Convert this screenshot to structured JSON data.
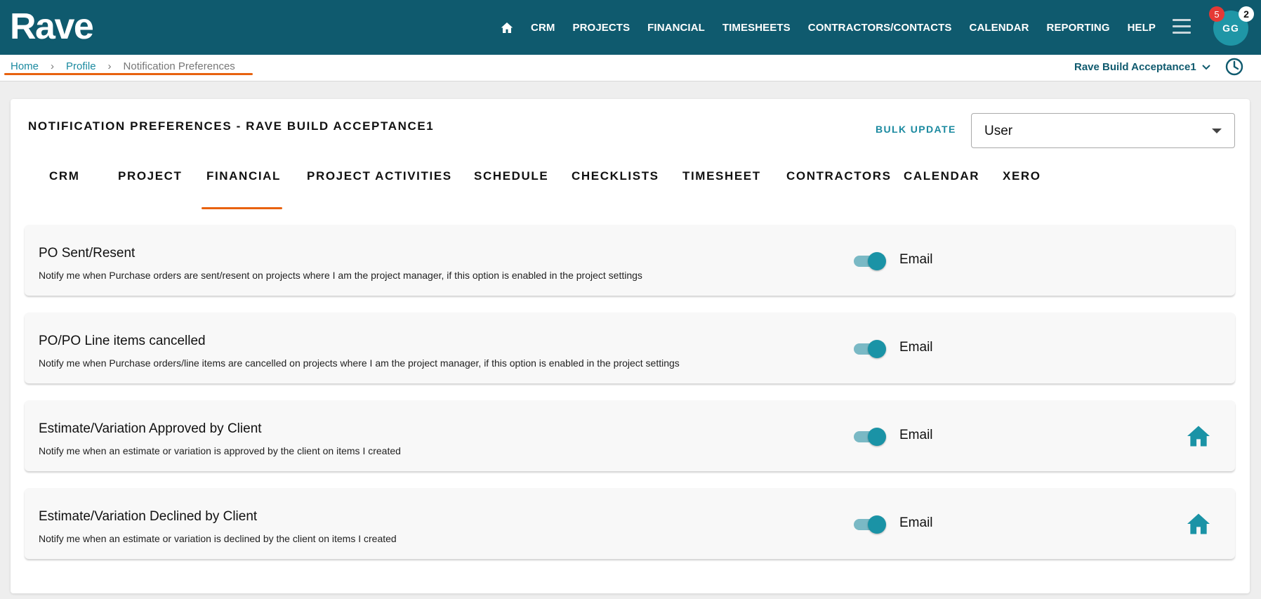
{
  "app": {
    "logo": "Rave"
  },
  "nav": {
    "items": [
      "CRM",
      "PROJECTS",
      "FINANCIAL",
      "TIMESHEETS",
      "CONTRACTORS/CONTACTS",
      "CALENDAR",
      "REPORTING",
      "HELP"
    ],
    "icons": {
      "home": "home-icon",
      "menu": "hamburger-menu-icon"
    }
  },
  "user": {
    "initials": "GG",
    "notification_count": "5",
    "secondary_count": "2"
  },
  "breadcrumb": {
    "home": "Home",
    "profile": "Profile",
    "current": "Notification Preferences"
  },
  "company": {
    "name": "Rave Build Acceptance1"
  },
  "page": {
    "title": "NOTIFICATION PREFERENCES - RAVE BUILD ACCEPTANCE1",
    "bulk_update": "BULK UPDATE",
    "select_value": "User"
  },
  "tabs": [
    "CRM",
    "PROJECT",
    "FINANCIAL",
    "PROJECT ACTIVITIES",
    "SCHEDULE",
    "CHECKLISTS",
    "TIMESHEET",
    "CONTRACTORS",
    "CALENDAR",
    "XERO"
  ],
  "active_tab": "FINANCIAL",
  "preferences": [
    {
      "title": "PO Sent/Resent",
      "description": "Notify me when Purchase orders are sent/resent on projects where I am the project manager, if this option is enabled in the project settings",
      "channel": "Email",
      "enabled": true,
      "home_icon": false
    },
    {
      "title": "PO/PO Line items cancelled",
      "description": "Notify me when Purchase orders/line items are cancelled on projects where I am the project manager, if this option is enabled in the project settings",
      "channel": "Email",
      "enabled": true,
      "home_icon": false
    },
    {
      "title": "Estimate/Variation Approved by Client",
      "description": "Notify me when an estimate or variation is approved by the client on items I created",
      "channel": "Email",
      "enabled": true,
      "home_icon": true
    },
    {
      "title": "Estimate/Variation Declined by Client",
      "description": "Notify me when an estimate or variation is declined by the client on items I created",
      "channel": "Email",
      "enabled": true,
      "home_icon": true
    }
  ],
  "colors": {
    "header": "#0f5a6e",
    "accent": "#1b8aa0",
    "underline": "#e8620f",
    "toggle_on": "#1a93a6"
  }
}
